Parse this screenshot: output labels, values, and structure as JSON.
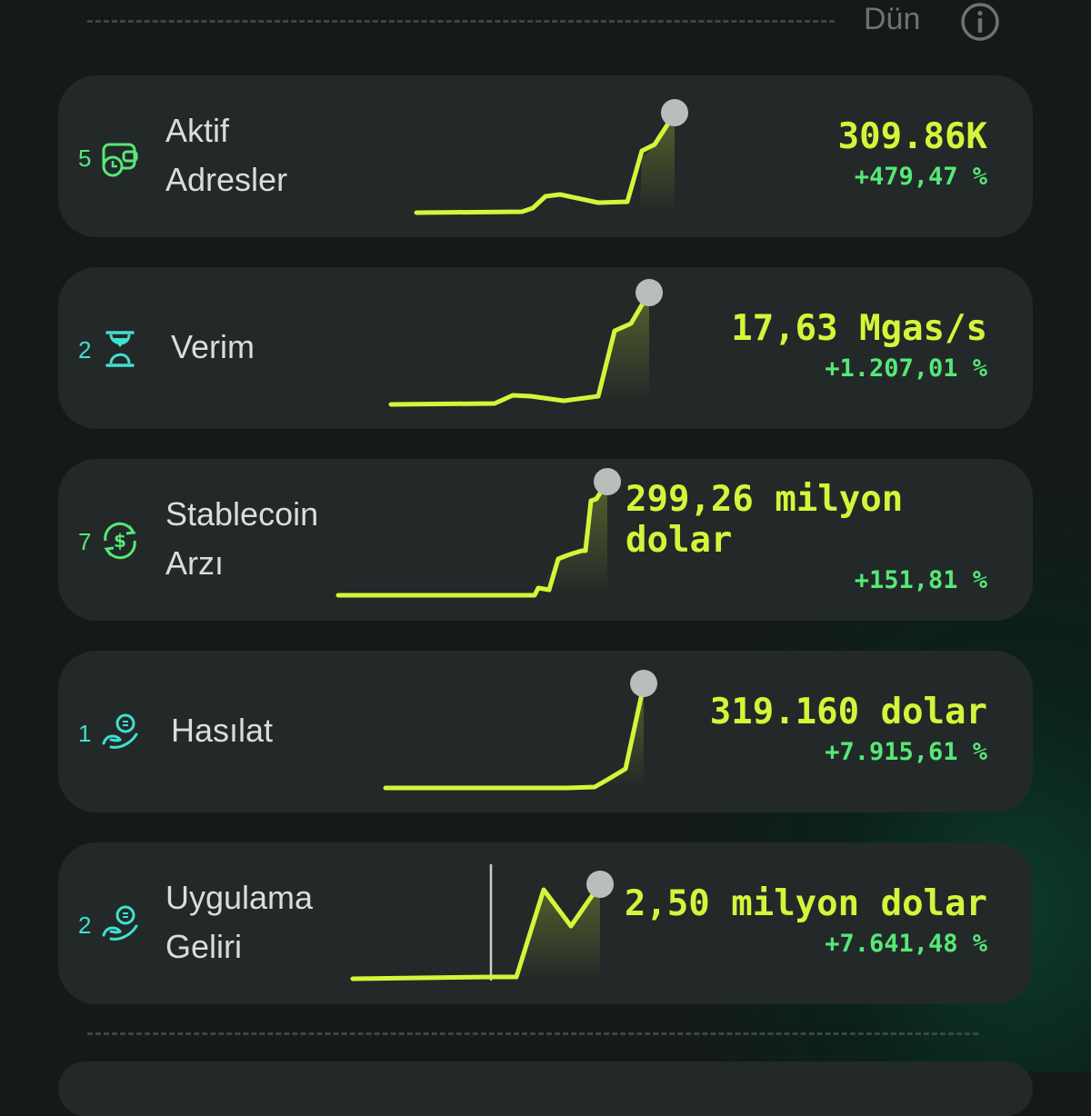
{
  "header": {
    "period_label": "Dün",
    "info_icon": "info-icon"
  },
  "colors": {
    "accent": "#d4f53a",
    "positive": "#56e878",
    "rank_teal": "#3fe0d0",
    "card_bg": "#232928"
  },
  "metrics": [
    {
      "rank": "5",
      "icon": "wallet-clock-icon",
      "label_line1": "Aktif",
      "label_line2": "Adresler",
      "value": "309.86K",
      "change": "+479,47 %"
    },
    {
      "rank": "2",
      "icon": "hourglass-icon",
      "label_line1": "Verim",
      "label_line2": "",
      "value": "17,63 Mgas/s",
      "change": "+1.207,01 %"
    },
    {
      "rank": "7",
      "icon": "dollar-cycle-icon",
      "label_line1": "Stablecoin",
      "label_line2": "Arzı",
      "value_line1": "299,26 milyon",
      "value_line2": "dolar",
      "change": "+151,81 %"
    },
    {
      "rank": "1",
      "icon": "coin-hand-icon",
      "label_line1": "Hasılat",
      "label_line2": "",
      "value": "319.160 dolar",
      "change": "+7.915,61 %"
    },
    {
      "rank": "2",
      "icon": "coin-hand-icon",
      "label_line1": "Uygulama",
      "label_line2": "Geliri",
      "value": "2,50 milyon dolar",
      "change": "+7.641,48 %"
    }
  ]
}
